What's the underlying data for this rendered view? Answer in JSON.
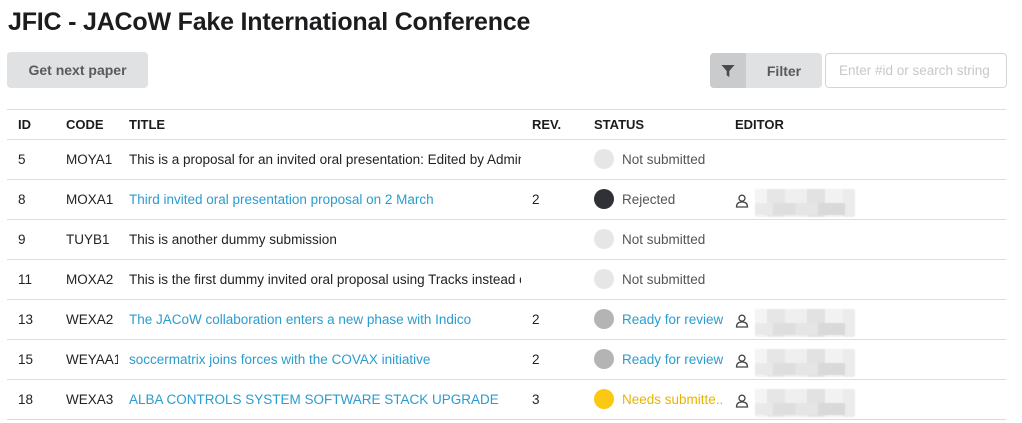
{
  "header": {
    "title": "JFIC - JACoW Fake International Conference"
  },
  "toolbar": {
    "next_paper_label": "Get next paper",
    "filter_label": "Filter",
    "search_placeholder": "Enter #id or search string",
    "search_value": ""
  },
  "table": {
    "columns": {
      "id": "ID",
      "code": "CODE",
      "title": "TITLE",
      "rev": "REV.",
      "status": "STATUS",
      "editor": "EDITOR"
    },
    "rows": [
      {
        "id": "5",
        "code": "MOYA1",
        "title": "This is a proposal for an invited oral presentation: Edited by Admin",
        "title_is_link": false,
        "rev": "",
        "status": "Not submitted",
        "status_color": "#e6e6e6",
        "status_text_color": "#555555",
        "has_editor": false
      },
      {
        "id": "8",
        "code": "MOXA1",
        "title": "Third invited oral presentation proposal on 2 March",
        "title_is_link": true,
        "rev": "2",
        "status": "Rejected",
        "status_color": "#2f3136",
        "status_text_color": "#555555",
        "has_editor": true
      },
      {
        "id": "9",
        "code": "TUYB1",
        "title": "This is another dummy submission",
        "title_is_link": false,
        "rev": "",
        "status": "Not submitted",
        "status_color": "#e6e6e6",
        "status_text_color": "#555555",
        "has_editor": false
      },
      {
        "id": "11",
        "code": "MOXA2",
        "title": "This is the first dummy invited oral proposal using Tracks instead of",
        "title_is_link": false,
        "rev": "",
        "status": "Not submitted",
        "status_color": "#e6e6e6",
        "status_text_color": "#555555",
        "has_editor": false
      },
      {
        "id": "13",
        "code": "WEXA2",
        "title": "The JACoW collaboration enters a new phase with Indico",
        "title_is_link": true,
        "rev": "2",
        "status": "Ready for review",
        "status_color": "#b4b4b4",
        "status_text_color": "#2a9ccf",
        "has_editor": true
      },
      {
        "id": "15",
        "code": "WEYAA1",
        "title": "soccermatrix joins forces with the COVAX initiative",
        "title_is_link": true,
        "rev": "2",
        "status": "Ready for review",
        "status_color": "#b4b4b4",
        "status_text_color": "#2a9ccf",
        "has_editor": true
      },
      {
        "id": "18",
        "code": "WEXA3",
        "title": "ALBA CONTROLS SYSTEM SOFTWARE STACK UPGRADE",
        "title_is_link": true,
        "rev": "3",
        "status": "Needs submitte...",
        "status_color": "#fbc812",
        "status_text_color": "#e8b400",
        "has_editor": true
      }
    ]
  }
}
